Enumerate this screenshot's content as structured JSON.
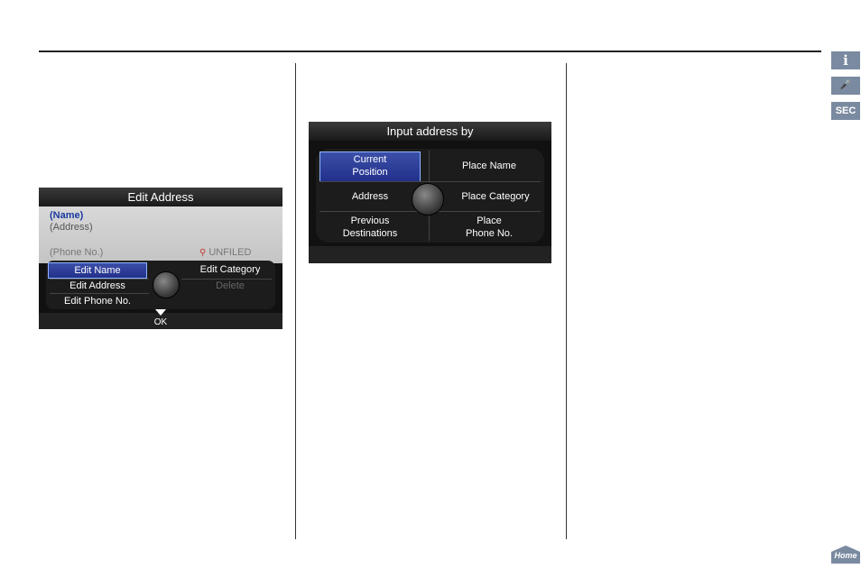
{
  "screen1": {
    "title": "Edit Address",
    "name": "(Name)",
    "address": "(Address)",
    "phone": "(Phone No.)",
    "unfiled": "UNFILED",
    "menu": {
      "edit_name": "Edit Name",
      "edit_category": "Edit Category",
      "edit_address": "Edit Address",
      "delete": "Delete",
      "edit_phone": "Edit Phone No."
    },
    "ok": "OK"
  },
  "screen2": {
    "title": "Input address by",
    "current_position": [
      "Current",
      "Position"
    ],
    "place_name": "Place Name",
    "address": "Address",
    "place_category": "Place Category",
    "previous_destinations": [
      "Previous",
      "Destinations"
    ],
    "place_phone": [
      "Place",
      "Phone No."
    ]
  },
  "tabs": {
    "info": "i",
    "voice": "🎤",
    "sec": "SEC",
    "home": "Home"
  },
  "colors": {
    "highlight": "#2c3c9a",
    "name_text": "#1a3aa0",
    "tab_bg": "#7a8aa0"
  }
}
